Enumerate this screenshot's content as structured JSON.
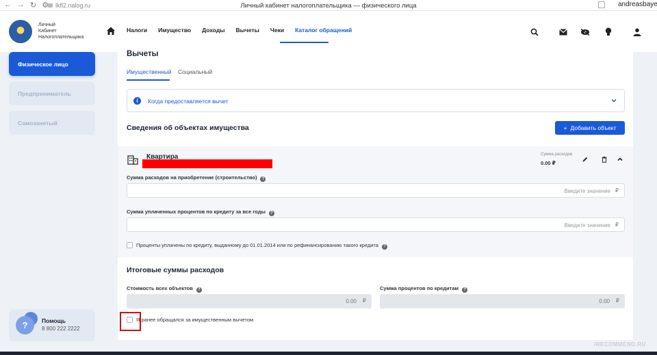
{
  "browser": {
    "url": "lkfl2.nalog.ru",
    "title": "Личный кабинет налогоплательщика — физического лица",
    "user": "andreasbayer"
  },
  "header": {
    "logo_text": [
      "Личный",
      "Кабинет",
      "Налогоплательщика"
    ],
    "nav": [
      "Налоги",
      "Имущество",
      "Доходы",
      "Вычеты",
      "Чеки",
      "Каталог обращений"
    ],
    "active_nav": "Каталог обращений",
    "icons": [
      "search-icon",
      "mail-icon",
      "hide-icon",
      "lightbulb-icon",
      "profile-icon"
    ]
  },
  "sidebar": {
    "items": [
      {
        "label": "Физическое лицо",
        "active": true
      },
      {
        "label": "Предприниматель",
        "active": false
      },
      {
        "label": "Самозанятый",
        "active": false
      }
    ],
    "help": {
      "title": "Помощь",
      "phone": "8 800 222 2222"
    }
  },
  "main": {
    "title": "Вычеты",
    "tabs": [
      {
        "label": "Имущественный",
        "active": true
      },
      {
        "label": "Социальный",
        "active": false
      }
    ],
    "info": "Когда предоставляется вычет",
    "objects_title": "Сведения об объектах имущества",
    "add_button": "Добавить объект",
    "property": {
      "name": "Квартира",
      "sum_label": "Сумма расходов",
      "sum_value": "0.00 ₽",
      "expense_label": "Сумма расходов на приобретение (строительство)",
      "expense_placeholder": "Введите значение",
      "interest_label": "Сумма уплаченных процентов по кредиту за все годы",
      "interest_placeholder": "Введите значение",
      "refinance_label": "Проценты уплачены по кредиту, выданному до 01.01.2014 или по рефинансированию такого кредита",
      "currency": "₽"
    },
    "totals": {
      "title": "Итоговые суммы расходов",
      "objects_cost_label": "Стоимость всех объектов",
      "objects_cost_value": "0.00",
      "interest_sum_label": "Сумма процентов по кредитам",
      "interest_sum_value": "0.00",
      "previous_label": "Я ранее обращался за имущественным вычетом"
    }
  },
  "colors": {
    "accent": "#1a5ad7",
    "redaction": "#ff0000"
  },
  "watermark": "iRECOMMEND.RU"
}
